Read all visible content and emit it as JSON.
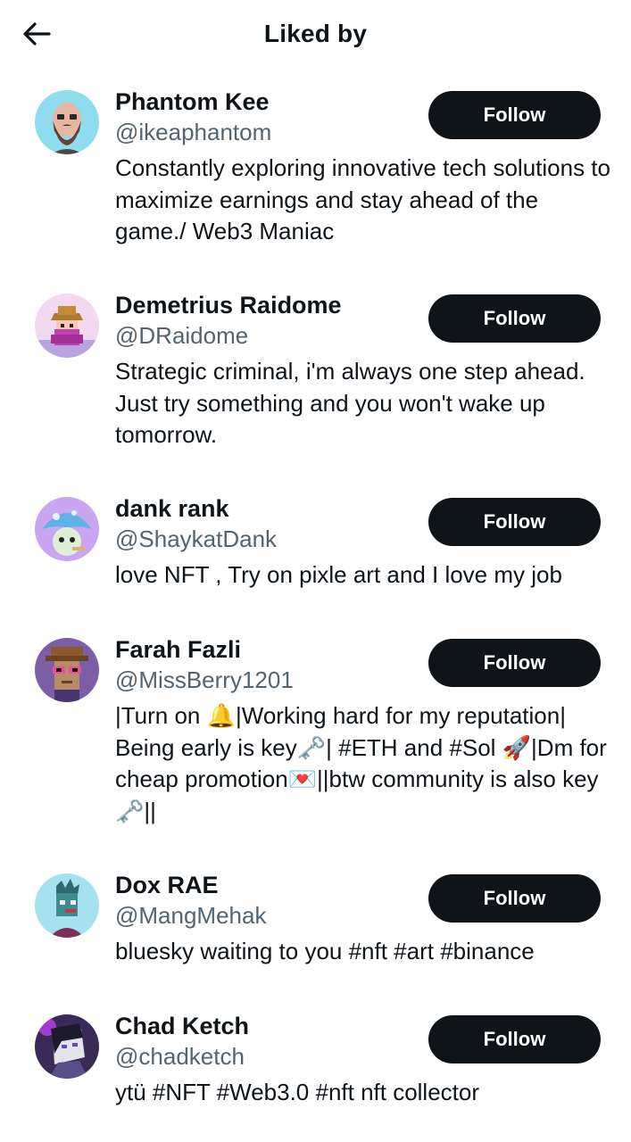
{
  "header": {
    "title": "Liked by",
    "back_icon": "arrow-left-icon"
  },
  "users": [
    {
      "name": "Phantom Kee",
      "handle": "@ikeaphantom",
      "bio": "Constantly exploring innovative tech solutions to maximize earnings and stay ahead of the game./ Web3 Maniac",
      "follow_label": "Follow",
      "avatar_bg": "#8fdcef"
    },
    {
      "name": "Demetrius Raidome",
      "handle": "@DRaidome",
      "bio": "Strategic criminal, i'm always one step ahead. Just try something and you won't wake up tomorrow.",
      "follow_label": "Follow",
      "avatar_bg": "#f2d9ef"
    },
    {
      "name": "dank rank",
      "handle": "@ShaykatDank",
      "bio": "love NFT , Try on pixle art and I love my job",
      "follow_label": "Follow",
      "avatar_bg": "#c9a6ef"
    },
    {
      "name": "Farah Fazli",
      "handle": "@MissBerry1201",
      "bio": "|Turn on 🔔|Working hard for my reputation| Being early is key🗝️| #ETH and #Sol 🚀|Dm for cheap promotion💌||btw community is also key🗝️||",
      "follow_label": "Follow",
      "avatar_bg": "#7b5ea5"
    },
    {
      "name": "Dox RAE",
      "handle": "@MangMehak",
      "bio": "bluesky waiting to you #nft #art #binance",
      "follow_label": "Follow",
      "avatar_bg": "#a6e1ef"
    },
    {
      "name": "Chad Ketch",
      "handle": "@chadketch",
      "bio": "ytü #NFT #Web3.0 #nft nft collector",
      "follow_label": "Follow",
      "avatar_bg": "#3a2a57"
    }
  ]
}
